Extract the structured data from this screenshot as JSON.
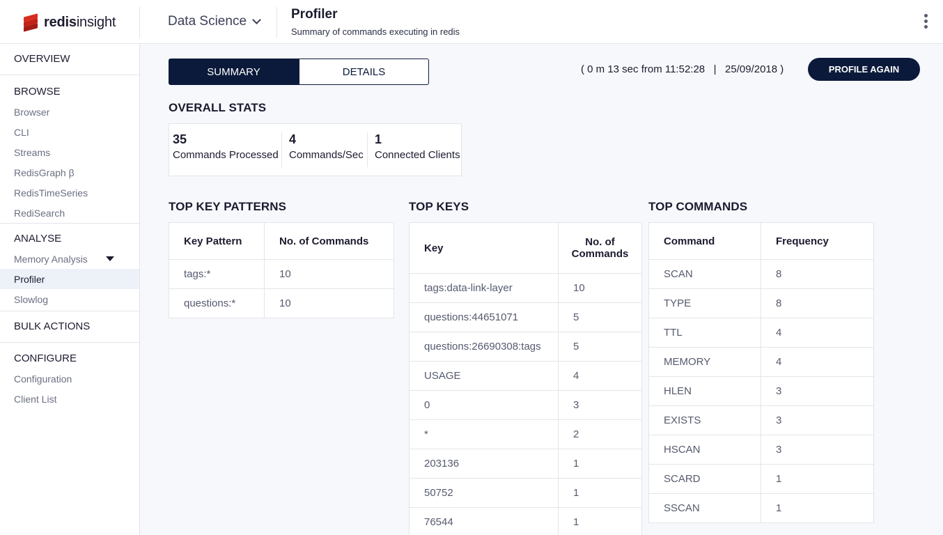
{
  "header": {
    "logo_text_bold": "redis",
    "logo_text_light": "insight",
    "database": "Data Science",
    "title": "Profiler",
    "subtitle": "Summary of commands executing in redis"
  },
  "sidebar": {
    "overview": "OVERVIEW",
    "browse": {
      "heading": "BROWSE",
      "items": [
        "Browser",
        "CLI",
        "Streams",
        "RedisGraph  β",
        "RedisTimeSeries",
        "RediSearch"
      ]
    },
    "analyse": {
      "heading": "ANALYSE",
      "items": [
        "Memory Analysis",
        "Profiler",
        "Slowlog"
      ],
      "active": "Profiler"
    },
    "bulk_actions": "BULK ACTIONS",
    "configure": {
      "heading": "CONFIGURE",
      "items": [
        "Configuration",
        "Client List"
      ]
    }
  },
  "tabs": [
    "SUMMARY",
    "DETAILS"
  ],
  "active_tab": "SUMMARY",
  "time_info": "( 0 m 13 sec from 11:52:28   |   25/09/2018 )",
  "profile_again": "PROFILE AGAIN",
  "overall_stats": {
    "title": "OVERALL STATS",
    "items": [
      {
        "value": "35",
        "label": "Commands Processed"
      },
      {
        "value": "4",
        "label": "Commands/Sec"
      },
      {
        "value": "1",
        "label": "Connected Clients"
      }
    ]
  },
  "top_key_patterns": {
    "title": "TOP KEY PATTERNS",
    "headers": [
      "Key Pattern",
      "No. of Commands"
    ],
    "rows": [
      [
        "tags:*",
        "10"
      ],
      [
        "questions:*",
        "10"
      ]
    ]
  },
  "top_keys": {
    "title": "TOP KEYS",
    "headers": [
      "Key",
      "No. of Commands"
    ],
    "rows": [
      [
        "tags:data-link-layer",
        "10"
      ],
      [
        "questions:44651071",
        "5"
      ],
      [
        "questions:26690308:tags",
        "5"
      ],
      [
        "USAGE",
        "4"
      ],
      [
        "0",
        "3"
      ],
      [
        "*",
        "2"
      ],
      [
        "203136",
        "1"
      ],
      [
        "50752",
        "1"
      ],
      [
        "76544",
        "1"
      ]
    ]
  },
  "top_commands": {
    "title": "TOP COMMANDS",
    "headers": [
      "Command",
      "Frequency"
    ],
    "rows": [
      [
        "SCAN",
        "8"
      ],
      [
        "TYPE",
        "8"
      ],
      [
        "TTL",
        "4"
      ],
      [
        "MEMORY",
        "4"
      ],
      [
        "HLEN",
        "3"
      ],
      [
        "EXISTS",
        "3"
      ],
      [
        "HSCAN",
        "3"
      ],
      [
        "SCARD",
        "1"
      ],
      [
        "SSCAN",
        "1"
      ]
    ]
  },
  "colors": {
    "navy": "#0b1a3a",
    "brand_red": "#d82c20",
    "active_bg": "#edf1f8"
  }
}
